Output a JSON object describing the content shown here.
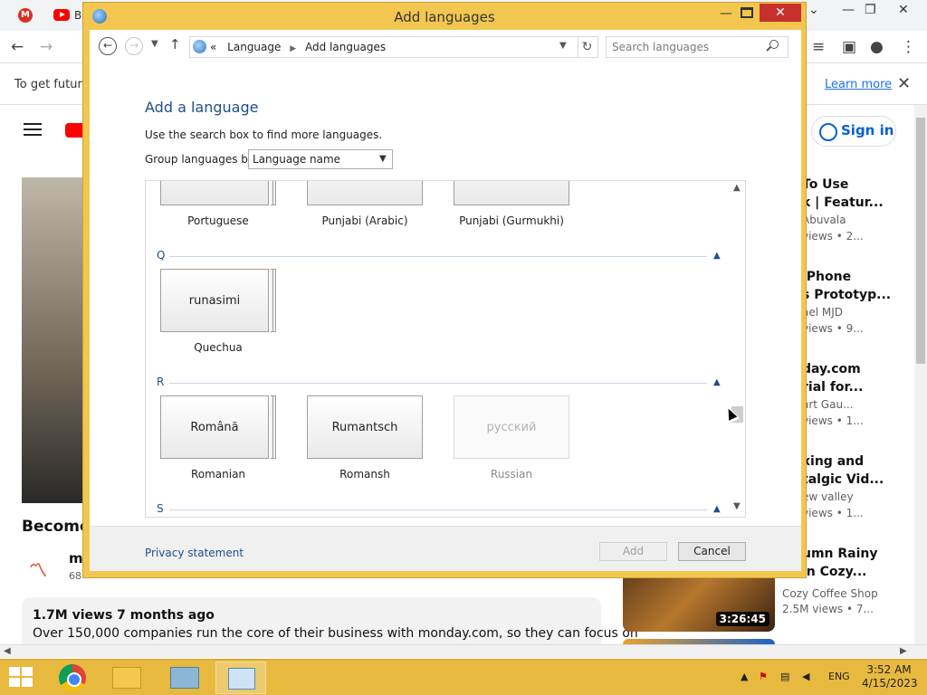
{
  "browser": {
    "tab_text": "B",
    "infobar_text": "To get future",
    "infobar_link": "Learn more",
    "signin_label": "Sign in",
    "video_title": "Become",
    "channel_name": "m",
    "channel_subs": "68",
    "desc_views": "1.7M views  7 months ago",
    "desc_text": "Over 150,000 companies run the core of their business with monday.com, so they can focus on",
    "sidebar": [
      {
        "t1": "To Use",
        "t2": "k | Featur...",
        "meta": "Abuvala",
        "meta2": "views • 2..."
      },
      {
        "t1": "iPhone",
        "t2": "s Prototyp...",
        "meta": "ael MJD",
        "meta2": "views • 9..."
      },
      {
        "t1": "day.com",
        "t2": "rial for...",
        "meta": "art Gau...",
        "meta2": "views • 1..."
      },
      {
        "t1": "xing and",
        "t2": "talgic Vid...",
        "meta": "ew valley",
        "meta2": "views • 1..."
      },
      {
        "t1": "umn Rainy",
        "t2": "in Cozy...",
        "meta": "",
        "meta2": ""
      }
    ],
    "side_bottom_channel": "Cozy Coffee Shop",
    "side_bottom_meta": "2.5M views • 7...",
    "thumb_duration": "3:26:45"
  },
  "dialog": {
    "title": "Add languages",
    "close_glyph": "✕",
    "address": {
      "prefix": "«",
      "crumb1": "Language",
      "crumb2": "Add languages"
    },
    "search_placeholder": "Search languages",
    "heading": "Add a language",
    "hint": "Use the search box to find more languages.",
    "group_label": "Group languages by:",
    "group_value": "Language name",
    "sections": [
      {
        "letter": "Q",
        "tiles": [
          {
            "native": "runasimi",
            "name": "Quechua",
            "enabled": true
          }
        ]
      },
      {
        "letter": "R",
        "tiles": [
          {
            "native": "Română",
            "name": "Romanian",
            "enabled": true
          },
          {
            "native": "Rumantsch",
            "name": "Romansh",
            "enabled": true
          },
          {
            "native": "русский",
            "name": "Russian",
            "enabled": false
          }
        ]
      },
      {
        "letter": "S",
        "tiles": []
      }
    ],
    "top_row": [
      {
        "name": "Portuguese"
      },
      {
        "name": "Punjabi (Arabic)"
      },
      {
        "name": "Punjabi (Gurmukhi)"
      }
    ],
    "footer": {
      "privacy": "Privacy statement",
      "add": "Add",
      "cancel": "Cancel"
    }
  },
  "taskbar": {
    "lang": "ENG",
    "time": "3:52 AM",
    "date": "4/15/2023"
  },
  "colors": {
    "accent": "#f3c74f",
    "taskbar": "#e7b93e",
    "heading_blue": "#1e4e8c",
    "close_red": "#c7302b"
  }
}
